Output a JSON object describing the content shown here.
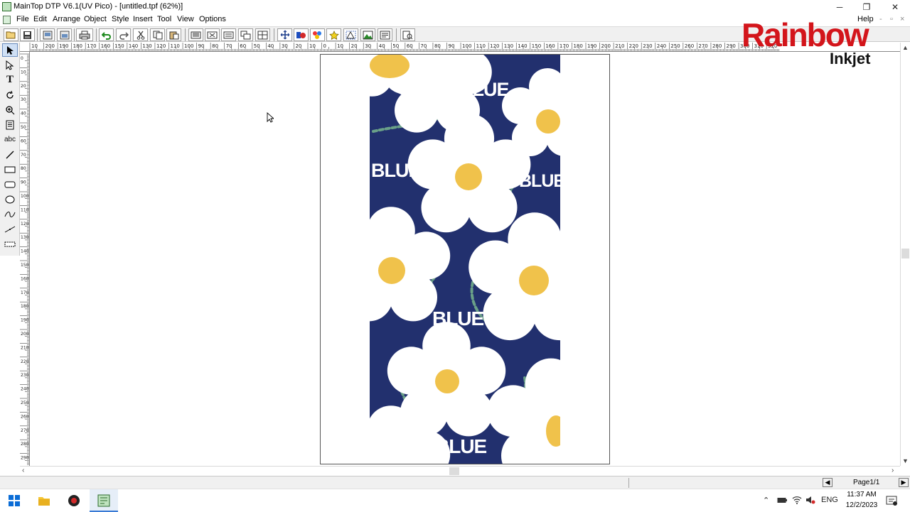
{
  "window": {
    "title": "MainTop DTP V6.1(UV Pico) - [untitled.tpf (62%)]",
    "minimize": "─",
    "restore": "❐",
    "close": "✕"
  },
  "menu": {
    "items": [
      "File",
      "Edit",
      "Arrange",
      "Object",
      "Style",
      "Insert",
      "Tool",
      "View",
      "Options"
    ],
    "help": "Help",
    "mdi_min": "-",
    "mdi_restore": "▫",
    "mdi_close": "×"
  },
  "toolbar": {
    "buttons": [
      "open-icon",
      "save-icon",
      "import-icon",
      "export-icon",
      "print-icon",
      "undo-icon",
      "redo-icon",
      "cut-icon",
      "copy-icon",
      "paste-icon",
      "align-left-icon",
      "align-center-icon",
      "align-right-icon",
      "group-icon",
      "ungroup-icon",
      "move-icon",
      "color-fill-icon",
      "palette-icon",
      "star-icon",
      "transform-icon",
      "bitmap-icon",
      "text-abc-icon",
      "preview-icon"
    ]
  },
  "tools": [
    "select-arrow-icon",
    "node-edit-icon",
    "text-tool-icon",
    "rotate-icon",
    "zoom-icon",
    "table-icon",
    "abc-text-icon",
    "line-icon",
    "rectangle-icon",
    "rounded-rect-icon",
    "ellipse-icon",
    "curve-icon",
    "polyline-icon",
    "measure-icon"
  ],
  "tool_labels": {
    "text": "T",
    "abc": "abc"
  },
  "ruler": {
    "h_labels": [
      "10",
      "200",
      "190",
      "180",
      "170",
      "160",
      "150",
      "140",
      "130",
      "120",
      "110",
      "100",
      "90",
      "80",
      "70",
      "60",
      "50",
      "40",
      "30",
      "20",
      "10",
      "0",
      "10",
      "20",
      "30",
      "40",
      "50",
      "60",
      "70",
      "80",
      "90",
      "100",
      "110",
      "120",
      "130",
      "140",
      "150",
      "160",
      "170",
      "180",
      "190",
      "200",
      "210",
      "220",
      "230",
      "240",
      "250",
      "260",
      "270",
      "280",
      "290",
      "300",
      "310",
      "320"
    ],
    "v_labels": [
      "0",
      "10",
      "20",
      "30",
      "40",
      "50",
      "60",
      "70",
      "80",
      "90",
      "100",
      "110",
      "120",
      "130",
      "140",
      "150",
      "160",
      "170",
      "180",
      "190",
      "200",
      "210",
      "220",
      "230",
      "240",
      "250",
      "260",
      "270",
      "280",
      "290"
    ]
  },
  "design": {
    "word": "BLUE",
    "colors": {
      "background": "#22306e",
      "petal": "#ffffff",
      "center": "#f0c24b",
      "dash": "#6aa088"
    }
  },
  "statusbar": {
    "page": "Page1/1"
  },
  "taskbar": {
    "language": "ENG",
    "time": "11:37 AM",
    "date": "12/2/2023"
  },
  "logo": {
    "brand": "Rainbow",
    "sub": "Inkjet"
  }
}
